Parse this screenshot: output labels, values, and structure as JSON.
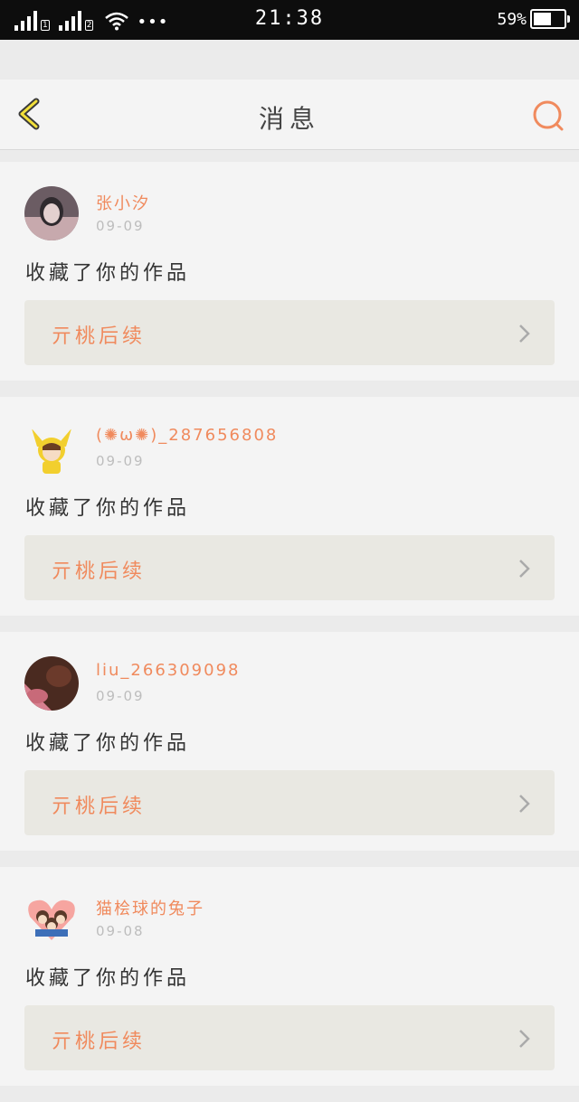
{
  "status_bar": {
    "sim1": "1",
    "sim2": "2",
    "dots": "•••",
    "time": "21:38",
    "battery_percent": "59%",
    "battery_level": 0.59
  },
  "nav": {
    "title": "消息",
    "back_icon": "chevron-left-icon",
    "search_icon": "search-icon",
    "accent": "#f08a5d"
  },
  "messages": [
    {
      "user": "张小汐",
      "date": "09-09",
      "action": "收藏了你的作品",
      "work": "亓桃后续",
      "avatar": "photo-avatar"
    },
    {
      "user": "(✺ω✺)_287656808",
      "date": "09-09",
      "action": "收藏了你的作品",
      "work": "亓桃后续",
      "avatar": "pikachu-avatar"
    },
    {
      "user": "liu_266309098",
      "date": "09-09",
      "action": "收藏了你的作品",
      "work": "亓桃后续",
      "avatar": "photo-avatar"
    },
    {
      "user": "猫桧球的兔子",
      "date": "09-08",
      "action": "收藏了你的作品",
      "work": "亓桃后续",
      "avatar": "group-avatar"
    }
  ]
}
